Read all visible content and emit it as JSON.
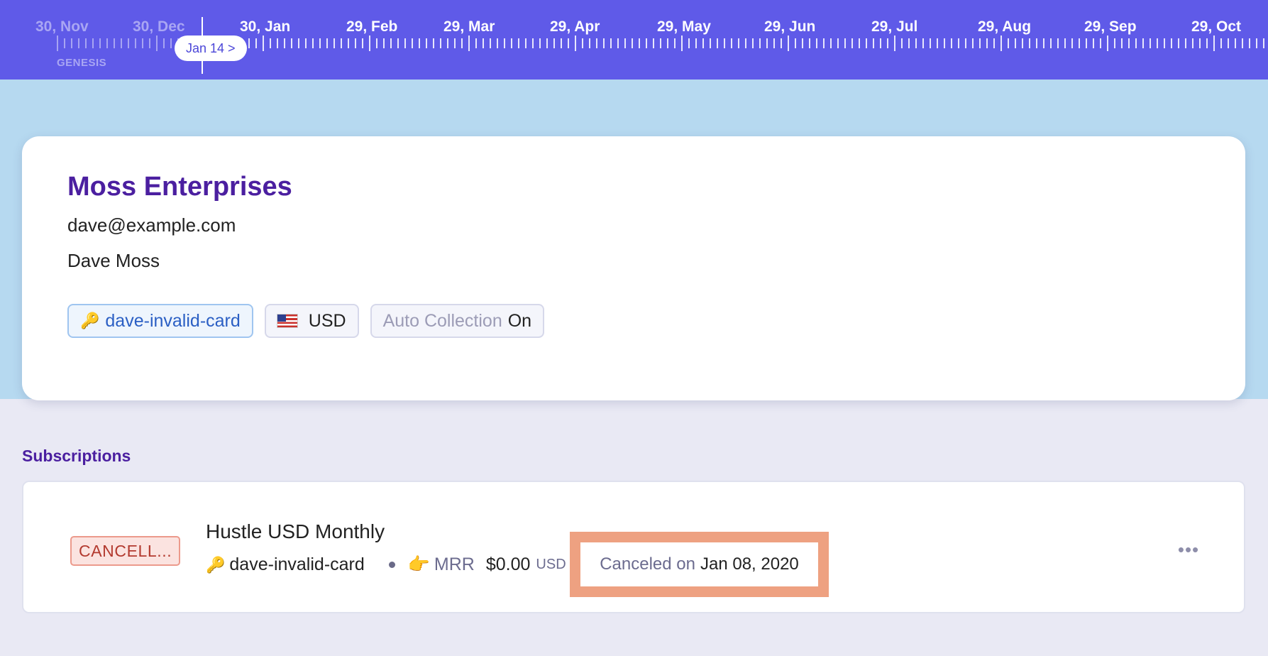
{
  "timeline": {
    "labels": [
      {
        "text": "30, Nov",
        "past": true
      },
      {
        "text": "30, Dec",
        "past": true
      },
      {
        "text": "30, Jan",
        "past": false
      },
      {
        "text": "29, Feb",
        "past": false
      },
      {
        "text": "29, Mar",
        "past": false
      },
      {
        "text": "29, Apr",
        "past": false
      },
      {
        "text": "29, May",
        "past": false
      },
      {
        "text": "29, Jun",
        "past": false
      },
      {
        "text": "29, Jul",
        "past": false
      },
      {
        "text": "29, Aug",
        "past": false
      },
      {
        "text": "29, Sep",
        "past": false
      },
      {
        "text": "29, Oct",
        "past": false
      }
    ],
    "genesis_label": "GENESIS",
    "current_date_label": "Jan 14 >"
  },
  "customer": {
    "name": "Moss Enterprises",
    "email": "dave@example.com",
    "contact_name": "Dave Moss",
    "key_label": "dave-invalid-card",
    "currency": "USD",
    "auto_collection_label": "Auto Collection",
    "auto_collection_value": "On"
  },
  "subscriptions": {
    "section_title": "Subscriptions",
    "items": [
      {
        "status": "CANCELL...",
        "plan_name": "Hustle USD Monthly",
        "key_label": "dave-invalid-card",
        "mrr_label": "MRR",
        "mrr_amount": "$0.00",
        "mrr_currency": "USD",
        "canceled_label": "Canceled on",
        "canceled_date": "Jan 08, 2020",
        "more_label": "•••"
      }
    ]
  },
  "colors": {
    "timeline_bg": "#5f5ae8",
    "hero_bg": "#b6d9f0",
    "page_bg": "#e9e9f4",
    "brand_purple": "#4b1fa0",
    "highlight_orange": "#eea181",
    "status_canceled": "#b33a2f"
  },
  "icons": {
    "key": "key-icon",
    "flag": "us-flag-icon",
    "pointing": "pointing-hand-icon",
    "more": "more-horizontal-icon"
  }
}
